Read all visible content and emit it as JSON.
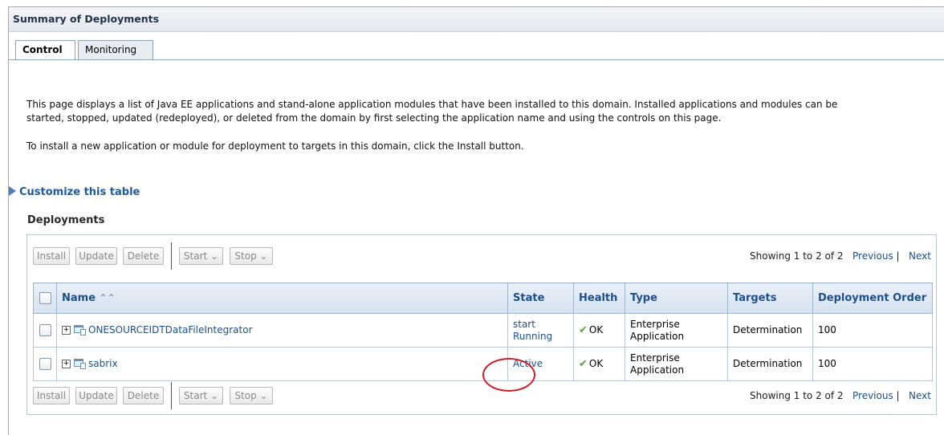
{
  "page": {
    "title": "Summary of Deployments",
    "tabs": [
      {
        "label": "Control",
        "active": true
      },
      {
        "label": "Monitoring",
        "active": false
      }
    ],
    "description_line1": "This page displays a list of Java EE applications and stand-alone application modules that have been installed to this domain. Installed applications and modules can be",
    "description_line2": "started, stopped, updated (redeployed), or deleted from the domain by first selecting the application name and using the controls on this page.",
    "description_line3": "To install a new application or module for deployment to targets in this domain, click the Install button.",
    "customize_link": "Customize this table",
    "section_title": "Deployments"
  },
  "toolbar": {
    "install": "Install",
    "update": "Update",
    "delete": "Delete",
    "start": "Start",
    "stop": "Stop",
    "showing": "Showing 1 to 2 of 2",
    "previous": "Previous",
    "next": "Next"
  },
  "table": {
    "headers": {
      "name": "Name",
      "state": "State",
      "health": "Health",
      "type": "Type",
      "targets": "Targets",
      "order": "Deployment Order"
    },
    "rows": [
      {
        "name": "ONESOURCEIDTDataFileIntegrator",
        "state_line1": "start",
        "state_line2": "Running",
        "health": "OK",
        "type_line1": "Enterprise",
        "type_line2": "Application",
        "targets": "Determination",
        "order": "100"
      },
      {
        "name": "sabrix",
        "state_line1": "Active",
        "state_line2": "",
        "health": "OK",
        "type_line1": "Enterprise",
        "type_line2": "Application",
        "targets": "Determination",
        "order": "100"
      }
    ]
  },
  "icons": {
    "customize": "triangle-right-icon",
    "sort": "sort-ascending-icon",
    "expand": "plus-box-icon",
    "app": "application-icon",
    "health": "checkmark-icon",
    "dropdown": "chevron-down-icon"
  },
  "colors": {
    "link": "#1f4f8a",
    "header_bg": "#d5e2f1",
    "check": "#5aa832",
    "annotation": "#c8202a"
  }
}
